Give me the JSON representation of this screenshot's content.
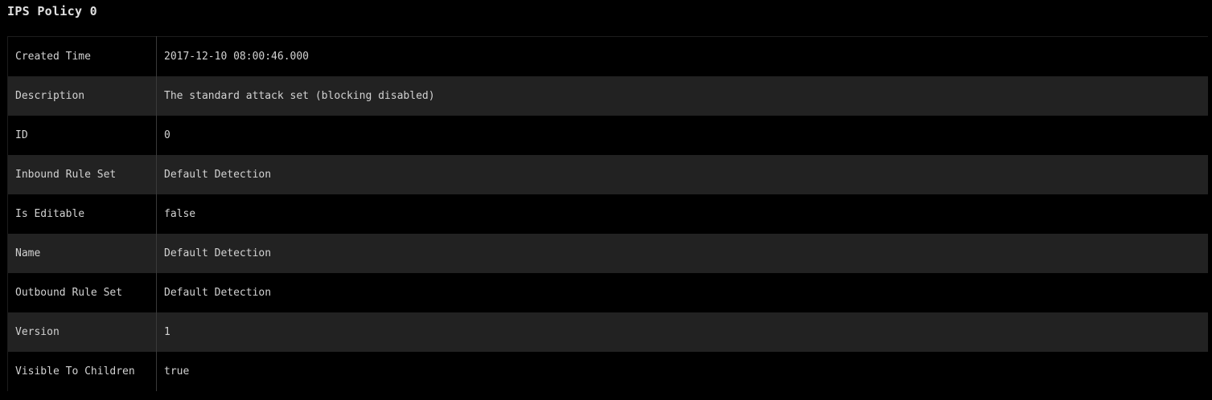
{
  "page": {
    "title": "IPS Policy 0"
  },
  "properties": [
    {
      "key": "Created Time",
      "value": "2017-12-10 08:00:46.000"
    },
    {
      "key": "Description",
      "value": "The standard attack set (blocking disabled)"
    },
    {
      "key": "ID",
      "value": "0"
    },
    {
      "key": "Inbound Rule Set",
      "value": "Default Detection"
    },
    {
      "key": "Is Editable",
      "value": "false"
    },
    {
      "key": "Name",
      "value": "Default Detection"
    },
    {
      "key": "Outbound Rule Set",
      "value": "Default Detection"
    },
    {
      "key": "Version",
      "value": "1"
    },
    {
      "key": "Visible To Children",
      "value": "true"
    }
  ],
  "colors": {
    "background": "#000000",
    "row_alt": "#222222",
    "text": "#d2d2d2"
  }
}
